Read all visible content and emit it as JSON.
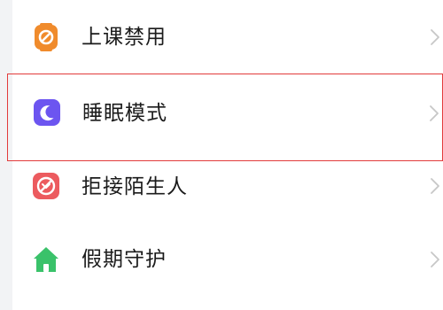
{
  "settings": {
    "items": [
      {
        "label": "上课禁用",
        "icon": "no-phone-class-icon",
        "color": "#f08b2c"
      },
      {
        "label": "睡眠模式",
        "icon": "moon-icon",
        "color": "#6c55f0",
        "selected": true
      },
      {
        "label": "拒接陌生人",
        "icon": "block-stranger-icon",
        "color": "#ec5b5f"
      },
      {
        "label": "假期守护",
        "icon": "home-icon",
        "color": "#3ac26a"
      }
    ]
  },
  "colors": {
    "selection_border": "#e23b3b",
    "chevron": "#c7c7c7",
    "text": "#1b1b1b",
    "background": "#ffffff"
  }
}
